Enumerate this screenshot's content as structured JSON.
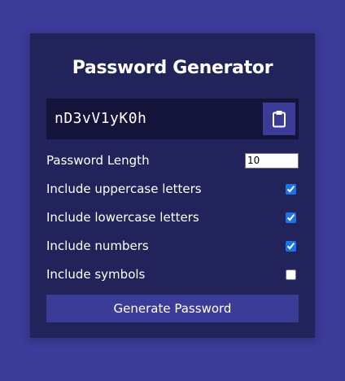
{
  "app": {
    "title": "Password Generator"
  },
  "result": {
    "password": "nD3vV1yK0h"
  },
  "settings": {
    "length_label": "Password Length",
    "length_value": "10",
    "uppercase_label": "Include uppercase letters",
    "uppercase_checked": true,
    "lowercase_label": "Include lowercase letters",
    "lowercase_checked": true,
    "numbers_label": "Include numbers",
    "numbers_checked": true,
    "symbols_label": "Include symbols",
    "symbols_checked": false
  },
  "actions": {
    "generate_label": "Generate Password",
    "clipboard_icon": "clipboard-icon"
  },
  "colors": {
    "page_background": "#3b3b98",
    "card_background": "#23235b",
    "result_background": "#14143a",
    "accent": "#3b3b98"
  }
}
